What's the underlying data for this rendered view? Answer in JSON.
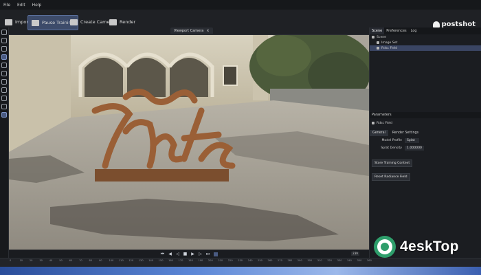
{
  "menu": [
    "File",
    "Edit",
    "Help"
  ],
  "toolbar": {
    "import": "Import...",
    "pause_training": "Pause Training",
    "create_camera": "Create Camera",
    "render": "Render"
  },
  "brand": "postshot",
  "viewport": {
    "tab_label": "Viewport Camera",
    "close": "×"
  },
  "panel": {
    "tabs": [
      "Scene",
      "Preferences",
      "Log"
    ],
    "tree": [
      "Scene",
      "Image Set",
      "Rdsc Field"
    ],
    "parameters_title": "Parameters",
    "selected_node": "Rdsc Field",
    "subtabs": [
      "General",
      "Render Settings"
    ],
    "model_profile_label": "Model Profile",
    "model_profile_value": "Splat",
    "splat_density_label": "Splat Density",
    "splat_density_value": "1.000000",
    "store_button": "Store Training Context",
    "reset_button": "Reset Radiance Field"
  },
  "timeline": {
    "frame": "239",
    "ticks": [
      "0",
      "10",
      "20",
      "30",
      "40",
      "50",
      "60",
      "70",
      "80",
      "90",
      "100",
      "110",
      "120",
      "130",
      "140",
      "150",
      "160",
      "170",
      "180",
      "190",
      "200",
      "210",
      "220",
      "230",
      "240",
      "250",
      "260",
      "270",
      "280",
      "290",
      "300",
      "310",
      "320",
      "330",
      "340",
      "350",
      "360"
    ]
  },
  "watermark": "4eskTop",
  "colors": {
    "accent": "#3d4b6a",
    "selection": "#3a4563",
    "panel": "#1b1d21"
  }
}
